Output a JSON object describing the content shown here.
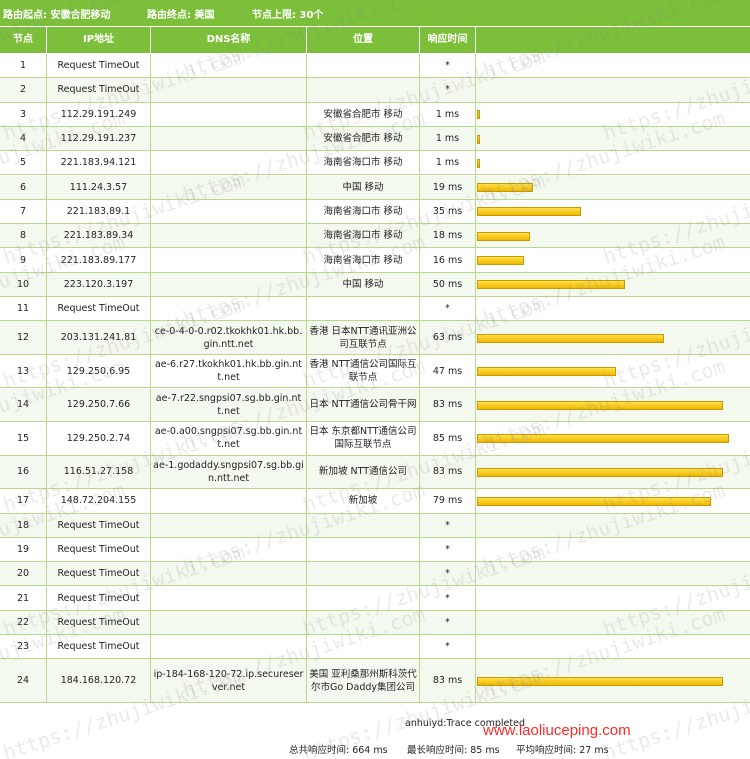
{
  "header": {
    "start": "路由起点: 安徽合肥移动",
    "end": "路由终点: 美国",
    "limit": "节点上限: 30个"
  },
  "columns": [
    "节点",
    "IP地址",
    "DNS名称",
    "位置",
    "响应时间"
  ],
  "hops": [
    {
      "n": "1",
      "ip": "Request TimeOut",
      "dns": "",
      "loc": "",
      "time": "*",
      "ms": null
    },
    {
      "n": "2",
      "ip": "Request TimeOut",
      "dns": "",
      "loc": "",
      "time": "*",
      "ms": null
    },
    {
      "n": "3",
      "ip": "112.29.191.249",
      "dns": "",
      "loc": "安徽省合肥市 移动",
      "time": "1 ms",
      "ms": 1
    },
    {
      "n": "4",
      "ip": "112.29.191.237",
      "dns": "",
      "loc": "安徽省合肥市 移动",
      "time": "1 ms",
      "ms": 1
    },
    {
      "n": "5",
      "ip": "221.183.94.121",
      "dns": "",
      "loc": "海南省海口市 移动",
      "time": "1 ms",
      "ms": 1
    },
    {
      "n": "6",
      "ip": "111.24.3.57",
      "dns": "",
      "loc": "中国 移动",
      "time": "19 ms",
      "ms": 19
    },
    {
      "n": "7",
      "ip": "221.183.89.1",
      "dns": "",
      "loc": "海南省海口市 移动",
      "time": "35 ms",
      "ms": 35
    },
    {
      "n": "8",
      "ip": "221.183.89.34",
      "dns": "",
      "loc": "海南省海口市 移动",
      "time": "18 ms",
      "ms": 18
    },
    {
      "n": "9",
      "ip": "221.183.89.177",
      "dns": "",
      "loc": "海南省海口市 移动",
      "time": "16 ms",
      "ms": 16
    },
    {
      "n": "10",
      "ip": "223.120.3.197",
      "dns": "",
      "loc": "中国 移动",
      "time": "50 ms",
      "ms": 50
    },
    {
      "n": "11",
      "ip": "Request TimeOut",
      "dns": "",
      "loc": "",
      "time": "*",
      "ms": null
    },
    {
      "n": "12",
      "ip": "203.131.241.81",
      "dns": "ce-0-4-0-0.r02.tkokhk01.hk.bb.gin.ntt.net",
      "loc": "香港 日本NTT通讯亚洲公司互联节点",
      "time": "63 ms",
      "ms": 63
    },
    {
      "n": "13",
      "ip": "129.250.6.95",
      "dns": "ae-6.r27.tkokhk01.hk.bb.gin.ntt.net",
      "loc": "香港 NTT通信公司国际互联节点",
      "time": "47 ms",
      "ms": 47
    },
    {
      "n": "14",
      "ip": "129.250.7.66",
      "dns": "ae-7.r22.sngpsi07.sg.bb.gin.ntt.net",
      "loc": "日本 NTT通信公司骨干网",
      "time": "83 ms",
      "ms": 83
    },
    {
      "n": "15",
      "ip": "129.250.2.74",
      "dns": "ae-0.a00.sngpsi07.sg.bb.gin.ntt.net",
      "loc": "日本 东京都NTT通信公司国际互联节点",
      "time": "85 ms",
      "ms": 85
    },
    {
      "n": "16",
      "ip": "116.51.27.158",
      "dns": "ae-1.godaddy.sngpsi07.sg.bb.gin.ntt.net",
      "loc": "新加坡 NTT通信公司",
      "time": "83 ms",
      "ms": 83
    },
    {
      "n": "17",
      "ip": "148.72.204.155",
      "dns": "",
      "loc": "新加坡",
      "time": "79 ms",
      "ms": 79
    },
    {
      "n": "18",
      "ip": "Request TimeOut",
      "dns": "",
      "loc": "",
      "time": "*",
      "ms": null
    },
    {
      "n": "19",
      "ip": "Request TimeOut",
      "dns": "",
      "loc": "",
      "time": "*",
      "ms": null
    },
    {
      "n": "20",
      "ip": "Request TimeOut",
      "dns": "",
      "loc": "",
      "time": "*",
      "ms": null
    },
    {
      "n": "21",
      "ip": "Request TimeOut",
      "dns": "",
      "loc": "",
      "time": "*",
      "ms": null
    },
    {
      "n": "22",
      "ip": "Request TimeOut",
      "dns": "",
      "loc": "",
      "time": "*",
      "ms": null
    },
    {
      "n": "23",
      "ip": "Request TimeOut",
      "dns": "",
      "loc": "",
      "time": "*",
      "ms": null
    },
    {
      "n": "24",
      "ip": "184.168.120.72",
      "dns": "ip-184-168-120-72.ip.secureserver.net",
      "loc": "美国 亚利桑那州斯科茨代尔市Go Daddy集团公司",
      "time": "83 ms",
      "ms": 83
    }
  ],
  "footer": {
    "status": "anhuiyd:Trace completed",
    "total": "总共响应时间:  664 ms",
    "max": "最长响应时间:  85 ms",
    "avg": "平均响应时间:   27 ms"
  },
  "watermark": {
    "url_text": "https://zhujiwiki.com",
    "site_text": "www.laoliuceping.com"
  },
  "colors": {
    "header_green": "#7cbf3a",
    "bar_yellow": "#f5c400",
    "site_red": "#ff2a2a"
  }
}
